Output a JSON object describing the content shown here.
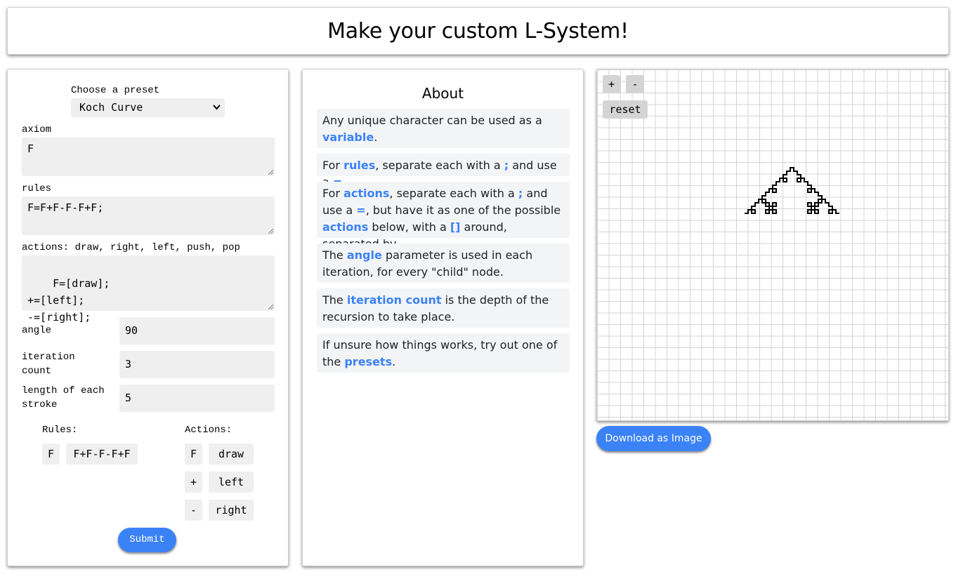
{
  "header": {
    "title": "Make your custom L-System!"
  },
  "form": {
    "preset_label": "Choose a preset",
    "preset_selected": "Koch Curve",
    "axiom_label": "axiom",
    "axiom_value": "F",
    "rules_label": "rules",
    "rules_value": "F=F+F-F-F+F;",
    "actions_label": "actions: draw, right, left, push, pop",
    "actions_value": "F=[draw];\n+=[left];\n-=[right];",
    "angle_label": "angle",
    "angle_value": "90",
    "iteration_label_line1": "iteration",
    "iteration_label_line2": "count",
    "iteration_value": "3",
    "length_label_line1": "length of each",
    "length_label_line2": "stroke",
    "length_value": "5",
    "rules_summary_title": "Rules:",
    "rules_summary": [
      {
        "key": "F",
        "value": "F+F-F-F+F"
      }
    ],
    "actions_summary_title": "Actions:",
    "actions_summary": [
      {
        "key": "F",
        "value": "draw"
      },
      {
        "key": "+",
        "value": "left"
      },
      {
        "key": "-",
        "value": "right"
      }
    ],
    "submit_label": "Submit"
  },
  "about": {
    "title": "About",
    "p1": {
      "a": "Any unique character can be used as a ",
      "h1": "variable",
      "b": "."
    },
    "p2": {
      "a": "For ",
      "h1": "rules",
      "b": ", separate each with a ",
      "h2": ";",
      "c": " and use a ",
      "h3": "=",
      "d": "."
    },
    "p3": {
      "a": "For ",
      "h1": "actions",
      "b": ", separate each with a ",
      "h2": ";",
      "c": " and use a ",
      "h3": "=",
      "d": ", but have it as one of the possible ",
      "h4": "actions",
      "e": " below, with a ",
      "h5": "[]",
      "f": " around, separated by ",
      "h6": ","
    },
    "p4": {
      "a": "The ",
      "h1": "angle",
      "b": " parameter is used in each iteration, for every \"child\" node."
    },
    "p5": {
      "a": "The ",
      "h1": "iteration count",
      "b": " is the depth of the recursion to take place."
    },
    "p6": {
      "a": "If unsure how things works, try out one of the ",
      "h1": "presets",
      "b": "."
    }
  },
  "canvas": {
    "zoom_in_label": "+",
    "zoom_out_label": "-",
    "reset_label": "reset",
    "download_label": "Download as Image"
  },
  "colors": {
    "accent": "#3b82f6",
    "field_bg": "#efefef",
    "grid": "#d4d4d4"
  }
}
